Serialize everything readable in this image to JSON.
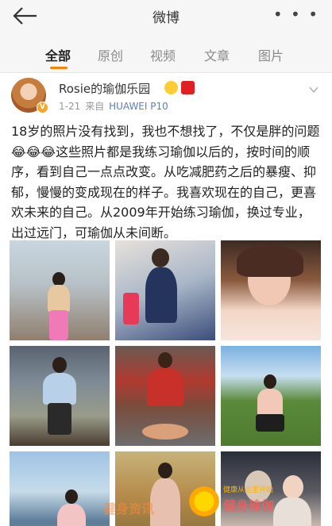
{
  "header": {
    "title": "微博",
    "back_icon": "back-arrow-icon",
    "more_icon": "more-dots-icon",
    "more_label": "• • •"
  },
  "tabs": [
    {
      "label": "全部",
      "active": true
    },
    {
      "label": "原创",
      "active": false
    },
    {
      "label": "视频",
      "active": false
    },
    {
      "label": "文章",
      "active": false
    },
    {
      "label": "图片",
      "active": false
    }
  ],
  "accent_color": "#ff8200",
  "post": {
    "username": "Rosie的瑜伽乐园",
    "date": "1-21",
    "source_prefix": "来自",
    "device": "HUAWEI P10",
    "verified_badge": "V",
    "text": "18岁的照片没有找到，我也不想找了，不仅是胖的问题😂😂😂这些照片都是我练习瑜伽以后的，按时间的顺序，看到自己一点点改变。从吃减肥药之后的暴瘦、抑郁，慢慢的变成现在的样子。我喜欢现在的自己，更喜欢未来的自己。从2009年开始练习瑜伽，换过专业，出过远门，可瑜伽从未间断。",
    "photo_count": 9
  },
  "watermark": {
    "left_text": "健身资讯",
    "top_text": "健康从这里开始",
    "main_text": "健身瑜伽"
  }
}
